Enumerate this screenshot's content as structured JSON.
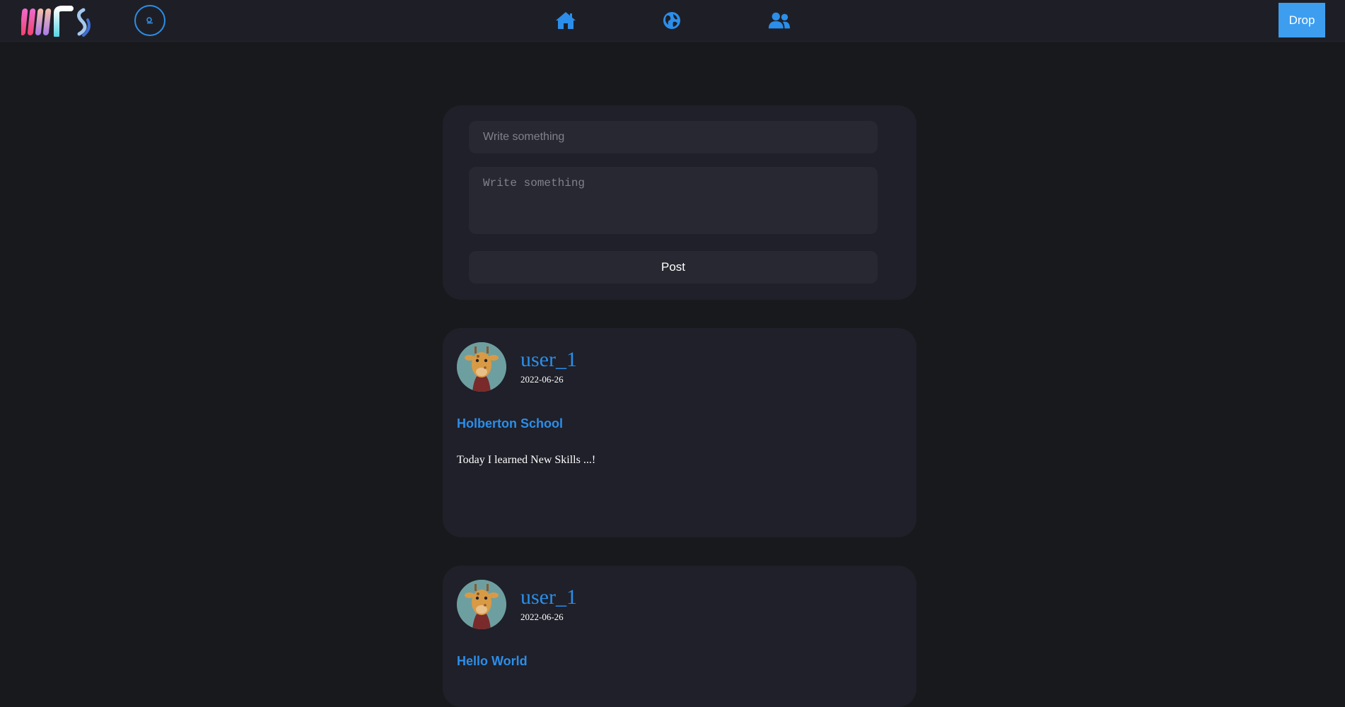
{
  "header": {
    "logo_text": "MFS",
    "drop_label": "Drop",
    "nav": [
      {
        "name": "home",
        "icon": "home-icon"
      },
      {
        "name": "explore",
        "icon": "globe-icon"
      },
      {
        "name": "friends",
        "icon": "users-icon"
      }
    ]
  },
  "composer": {
    "title_placeholder": "Write something",
    "body_placeholder": "Write something",
    "post_label": "Post"
  },
  "posts": [
    {
      "username": "user_1",
      "date": "2022-06-26",
      "title": "Holberton School",
      "body": "Today I learned New Skills ...!"
    },
    {
      "username": "user_1",
      "date": "2022-06-26",
      "title": "Hello World",
      "body": ""
    }
  ],
  "colors": {
    "accent": "#2b8eea",
    "drop_button": "#3d9ef0",
    "background": "#18191d",
    "card": "#1f2029"
  }
}
